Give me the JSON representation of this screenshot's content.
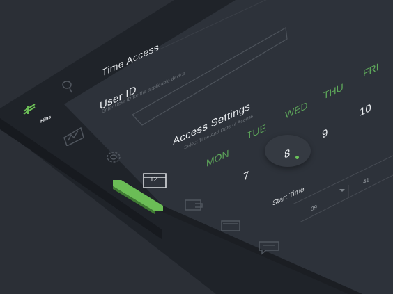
{
  "header": {
    "title": "Time Access"
  },
  "brand": {
    "name": "Hibs"
  },
  "user_id": {
    "label": "User ID",
    "hint": "Enter User ID for the applicable device"
  },
  "access": {
    "label": "Access Settings",
    "hint": "Select Time And Date of Access"
  },
  "days": [
    {
      "name": "MON",
      "date": "7"
    },
    {
      "name": "TUE",
      "date": "8"
    },
    {
      "name": "WED",
      "date": "9"
    },
    {
      "name": "THU",
      "date": "10"
    },
    {
      "name": "FRI",
      "date": ""
    }
  ],
  "selected_day": "8",
  "start_time": {
    "label": "Start Time",
    "hours": "09",
    "minutes": "41"
  },
  "sidebar": {
    "icons": [
      "search-icon",
      "chart-icon",
      "gear-icon",
      "calendar-icon",
      "wallet-icon",
      "card-icon",
      "chat-icon"
    ],
    "calendar_badge": "12"
  },
  "colors": {
    "accent": "#6bbd56",
    "background": "#2b2f36",
    "panel": "#2d323a",
    "sidebar": "#1f2329"
  }
}
